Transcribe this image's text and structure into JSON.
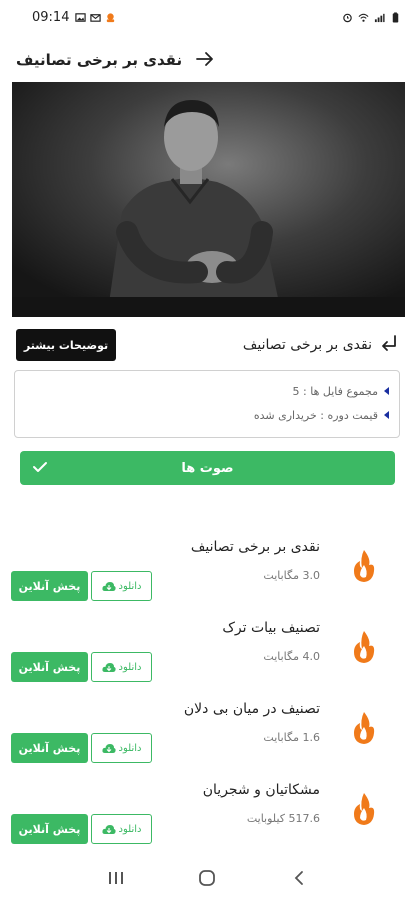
{
  "status_bar": {
    "time": "09:14",
    "left_icons": [
      "image-icon",
      "mail-icon",
      "notification-icon"
    ],
    "right_icons": [
      "alarm-icon",
      "wifi-icon",
      "signal-icon",
      "battery-icon"
    ]
  },
  "app_bar": {
    "title": "نقدی بر برخی تصانیف",
    "back_icon": "arrow-right-icon"
  },
  "course": {
    "title": "نقدی بر برخی تصانیف",
    "more_label": "توضیحات بیشتر",
    "info": {
      "files_count": "مجموع فایل ها : 5",
      "price": "قیمت دوره : خریداری شده"
    }
  },
  "section": {
    "label": "صوت ها"
  },
  "tracks": [
    {
      "title": "نقدی بر برخی تصانیف",
      "size": "3.0 مگابایت",
      "download_label": "دانلود",
      "play_label": "پخش آنلاین"
    },
    {
      "title": "تصنیف بیات ترک",
      "size": "4.0 مگابایت",
      "download_label": "دانلود",
      "play_label": "پخش آنلاین"
    },
    {
      "title": "تصنیف در میان بی دلان",
      "size": "1.6 مگابایت",
      "download_label": "دانلود",
      "play_label": "پخش آنلاین"
    },
    {
      "title": "مشکاتیان و شجریان",
      "size": "517.6 کیلوبایت",
      "download_label": "دانلود",
      "play_label": "پخش آنلاین"
    }
  ],
  "colors": {
    "accent": "#3cb964",
    "dark_button": "#111111",
    "bullet": "#1a2fa0",
    "flame": "#f07a1a"
  }
}
